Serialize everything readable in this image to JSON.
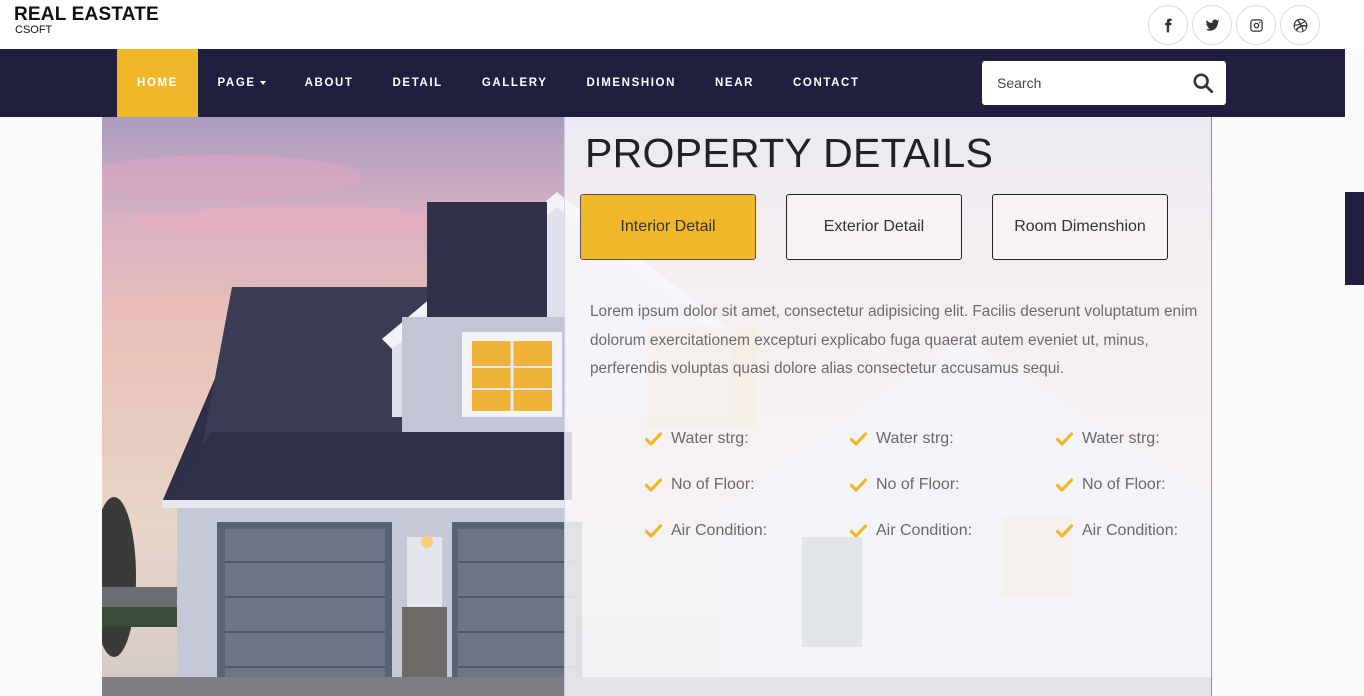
{
  "brand": {
    "name": "REAL EASTATE",
    "sub": "CSOFT"
  },
  "social": [
    "facebook-icon",
    "twitter-icon",
    "instagram-icon",
    "dribbble-icon"
  ],
  "nav": [
    {
      "label": "HOME",
      "active": true
    },
    {
      "label": "PAGE",
      "dropdown": true
    },
    {
      "label": "ABOUT"
    },
    {
      "label": "DETAIL"
    },
    {
      "label": "GALLERY"
    },
    {
      "label": "DIMENSHION"
    },
    {
      "label": "NEAR"
    },
    {
      "label": "CONTACT"
    }
  ],
  "search": {
    "placeholder": "Search",
    "value": ""
  },
  "section": {
    "title": "PROPERTY DETAILS",
    "tabs": [
      "Interior Detail",
      "Exterior Detail",
      "Room Dimenshion"
    ],
    "description": "Lorem ipsum dolor sit amet, consectetur adipisicing elit. Facilis deserunt voluptatum enim dolorum exercitationem excepturi explicabo fuga quaerat autem eveniet ut, minus, perferendis voluptas quasi dolore alias consectetur accusamus sequi.",
    "features": [
      [
        "Water strg:",
        "Water strg:",
        "Water strg:"
      ],
      [
        "No of Floor:",
        "No of Floor:",
        "No of Floor:"
      ],
      [
        "Air Condition:",
        "Air Condition:",
        "Air Condition:"
      ]
    ]
  },
  "colors": {
    "accent": "#f0b729",
    "navbar": "#1f1f3f"
  }
}
